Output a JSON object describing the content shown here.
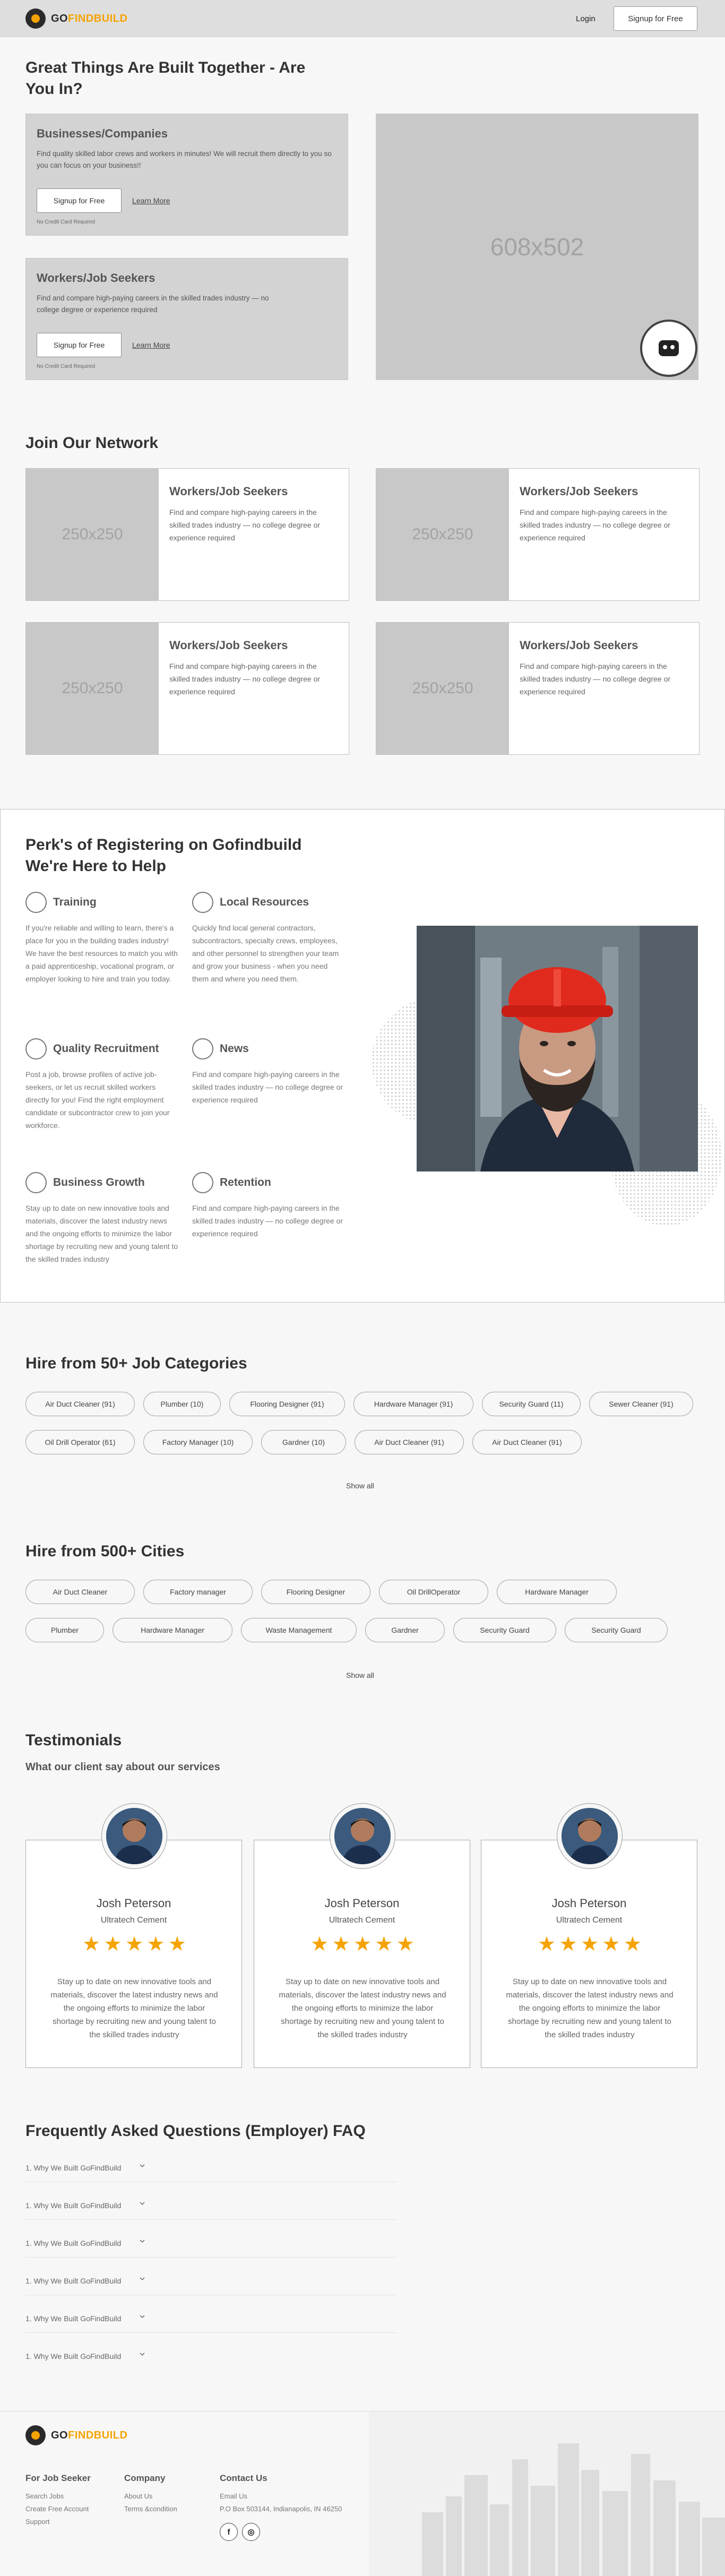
{
  "header": {
    "logo_go": "GO",
    "logo_find": "FINDBUILD",
    "login": "Login",
    "signup": "Signup for Free"
  },
  "hero": {
    "title": "Great Things Are Built Together - Are You In?",
    "businesses": {
      "title": "Businesses/Companies",
      "text": "Find quality skilled labor crews and workers in minutes! We will recruit them directly to you so you can focus on your business!!",
      "signup": "Signup for Free",
      "learn": "Learn More",
      "note": "No Credit Card Required"
    },
    "workers": {
      "title": "Workers/Job Seekers",
      "text": "Find and compare high-paying careers in the skilled trades industry — no college degree or experience required",
      "signup": "Signup for Free",
      "learn": "Learn More",
      "note": "No Credit Card Required"
    },
    "image_placeholder": "608x502"
  },
  "network": {
    "title": "Join Our Network",
    "cards": [
      {
        "img": "250x250",
        "title": "Workers/Job Seekers",
        "text": "Find and compare high-paying careers in the skilled trades industry — no college degree or experience required"
      },
      {
        "img": "250x250",
        "title": "Workers/Job Seekers",
        "text": "Find and compare high-paying careers in the skilled trades industry — no college degree or experience required"
      },
      {
        "img": "250x250",
        "title": "Workers/Job Seekers",
        "text": "Find and compare high-paying careers in the skilled trades industry — no college degree or experience required"
      },
      {
        "img": "250x250",
        "title": "Workers/Job Seekers",
        "text": "Find and compare high-paying careers in the skilled trades industry — no college degree or experience required"
      }
    ]
  },
  "perks": {
    "title_line1": "Perk's of Registering on Gofindbuild",
    "title_line2": "We're Here to Help",
    "items": [
      {
        "title": "Training",
        "text": "If you're reliable and willing to learn, there's a place for you in the building trades industry! We have the best resources to match you with a paid apprenticeship, vocational program, or employer looking to hire and train you today."
      },
      {
        "title": "Local Resources",
        "text": "Quickly find local general contractors, subcontractors, specialty crews, employees, and other personnel to strengthen your team and grow your business - when you need them and where you need them."
      },
      {
        "title": "Quality Recruitment",
        "text": "Post a job, browse profiles of active job-seekers, or let us recruit skilled workers directly for you! Find the right employment candidate or subcontractor crew to join your workforce."
      },
      {
        "title": "News",
        "text": "Find and compare high-paying careers in the skilled trades industry — no college degree or experience required"
      },
      {
        "title": "Business Growth",
        "text": "Stay up to date on new innovative tools and materials, discover the latest industry news and the ongoing efforts to minimize the labor shortage by recruiting new and young talent to the skilled trades industry"
      },
      {
        "title": "Retention",
        "text": "Find and compare high-paying careers in the skilled trades industry — no college degree or experience required"
      }
    ]
  },
  "categories": {
    "title": "Hire from 50+ Job Categories",
    "chips": [
      "Air Duct Cleaner (91)",
      "Plumber (10)",
      "Flooring Designer (91)",
      "Hardware Manager (91)",
      "Security Guard (11)",
      "Sewer Cleaner (91)",
      "Oil Drill Operator (61)",
      "Factory Manager (10)",
      "Gardner (10)",
      "Air Duct Cleaner (91)",
      "Air Duct Cleaner (91)"
    ],
    "show_all": "Show all"
  },
  "cities": {
    "title": "Hire from 500+ Cities",
    "chips": [
      "Air Duct Cleaner",
      "Factory manager",
      "Flooring Designer",
      "Oil DrillOperator",
      "Hardware Manager",
      "Plumber",
      "Hardware Manager",
      "Waste Management",
      "Gardner",
      "Security Guard",
      "Security Guard"
    ],
    "show_all": "Show all"
  },
  "testimonials": {
    "title": "Testimonials",
    "subtitle": "What our client say about our services",
    "items": [
      {
        "name": "Josh Peterson",
        "company": "Ultratech Cement",
        "rating": 5,
        "text": "Stay up to date on new innovative tools and materials, discover the latest industry news and the ongoing efforts to minimize the labor shortage by recruiting new and young talent to the skilled trades industry"
      },
      {
        "name": "Josh Peterson",
        "company": "Ultratech Cement",
        "rating": 5,
        "text": "Stay up to date on new innovative tools and materials, discover the latest industry news and the ongoing efforts to minimize the labor shortage by recruiting new and young talent to the skilled trades industry"
      },
      {
        "name": "Josh Peterson",
        "company": "Ultratech Cement",
        "rating": 5,
        "text": "Stay up to date on new innovative tools and materials, discover the latest industry news and the ongoing efforts to minimize the labor shortage by recruiting new and young talent to the skilled trades industry"
      }
    ]
  },
  "faq": {
    "title": "Frequently Asked Questions (Employer) FAQ",
    "items": [
      "1. Why We Built GoFindBuild",
      "1. Why We Built GoFindBuild",
      "1. Why We Built GoFindBuild",
      "1. Why We Built GoFindBuild",
      "1. Why We Built GoFindBuild",
      "1. Why We Built GoFindBuild"
    ]
  },
  "footer": {
    "logo_go": "GO",
    "logo_find": "FINDBUILD",
    "col1_title": "For Job Seeker",
    "col1_links": [
      "Search Jobs",
      "Create Free Account",
      "Support"
    ],
    "col2_title": "Company",
    "col2_links": [
      "About Us",
      "Terms &condition"
    ],
    "col3_title": "Contact Us",
    "col3_links": [
      "Email Us",
      "P.O Box 503144, Indianapolis, IN 46250"
    ],
    "social": [
      "f",
      "◎"
    ]
  },
  "colors": {
    "accent": "#f5a300",
    "dark": "#2a2a2a",
    "placeholder": "#c8c8c8"
  }
}
